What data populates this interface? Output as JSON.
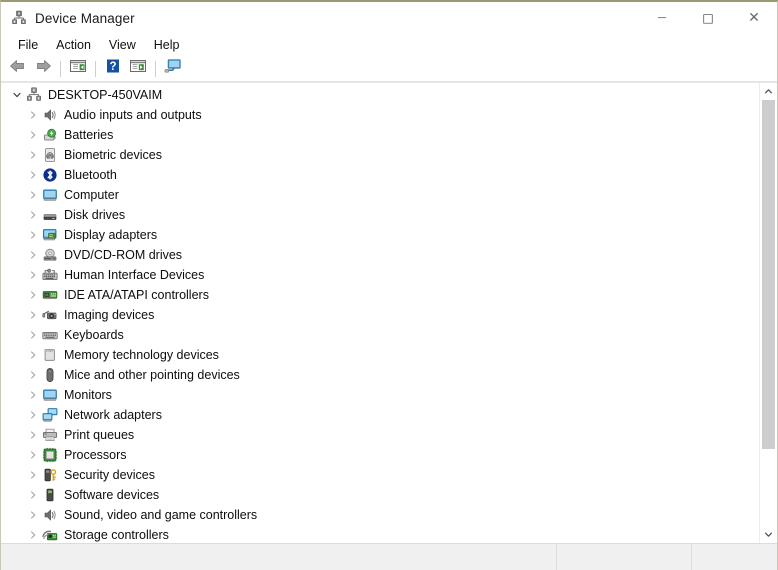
{
  "window": {
    "title": "Device Manager",
    "icon": "device-manager-icon",
    "controls": {
      "minimize": "─",
      "maximize": "□",
      "close": "✕"
    }
  },
  "menubar": {
    "items": [
      {
        "label": "File",
        "name": "menu-file"
      },
      {
        "label": "Action",
        "name": "menu-action"
      },
      {
        "label": "View",
        "name": "menu-view"
      },
      {
        "label": "Help",
        "name": "menu-help"
      }
    ]
  },
  "toolbar": {
    "buttons": [
      {
        "name": "back-button",
        "icon": "back-arrow-icon",
        "tooltip": "Back"
      },
      {
        "name": "forward-button",
        "icon": "forward-arrow-icon",
        "tooltip": "Forward"
      },
      {
        "name": "separator-1",
        "icon": "separator",
        "tooltip": ""
      },
      {
        "name": "show-hide-console-tree-button",
        "icon": "console-tree-icon",
        "tooltip": "Show/Hide Console Tree"
      },
      {
        "name": "separator-2",
        "icon": "separator",
        "tooltip": ""
      },
      {
        "name": "help-button",
        "icon": "help-question-icon",
        "tooltip": "Help"
      },
      {
        "name": "properties-button",
        "icon": "properties-icon",
        "tooltip": "Properties"
      },
      {
        "name": "separator-3",
        "icon": "separator",
        "tooltip": ""
      },
      {
        "name": "scan-for-hardware-changes-button",
        "icon": "monitor-scan-icon",
        "tooltip": "Scan for hardware changes"
      }
    ]
  },
  "tree": {
    "root": {
      "label": "DESKTOP-450VAIM",
      "icon": "computer-node-icon",
      "expanded": true
    },
    "items": [
      {
        "label": "Audio inputs and outputs",
        "icon": "speaker-icon",
        "expanded": false
      },
      {
        "label": "Batteries",
        "icon": "battery-icon",
        "expanded": false
      },
      {
        "label": "Biometric devices",
        "icon": "fingerprint-icon",
        "expanded": false
      },
      {
        "label": "Bluetooth",
        "icon": "bluetooth-icon",
        "expanded": false
      },
      {
        "label": "Computer",
        "icon": "monitor-icon",
        "expanded": false
      },
      {
        "label": "Disk drives",
        "icon": "disk-drive-icon",
        "expanded": false
      },
      {
        "label": "Display adapters",
        "icon": "display-adapter-icon",
        "expanded": false
      },
      {
        "label": "DVD/CD-ROM drives",
        "icon": "optical-drive-icon",
        "expanded": false
      },
      {
        "label": "Human Interface Devices",
        "icon": "hid-keyboard-icon",
        "expanded": false
      },
      {
        "label": "IDE ATA/ATAPI controllers",
        "icon": "ide-controller-icon",
        "expanded": false
      },
      {
        "label": "Imaging devices",
        "icon": "camera-icon",
        "expanded": false
      },
      {
        "label": "Keyboards",
        "icon": "keyboard-icon",
        "expanded": false
      },
      {
        "label": "Memory technology devices",
        "icon": "memory-card-icon",
        "expanded": false
      },
      {
        "label": "Mice and other pointing devices",
        "icon": "mouse-icon",
        "expanded": false
      },
      {
        "label": "Monitors",
        "icon": "monitor-icon",
        "expanded": false
      },
      {
        "label": "Network adapters",
        "icon": "network-adapter-icon",
        "expanded": false
      },
      {
        "label": "Print queues",
        "icon": "printer-icon",
        "expanded": false
      },
      {
        "label": "Processors",
        "icon": "processor-chip-icon",
        "expanded": false
      },
      {
        "label": "Security devices",
        "icon": "security-key-icon",
        "expanded": false
      },
      {
        "label": "Software devices",
        "icon": "software-device-icon",
        "expanded": false
      },
      {
        "label": "Sound, video and game controllers",
        "icon": "speaker-icon",
        "expanded": false
      },
      {
        "label": "Storage controllers",
        "icon": "storage-controller-icon",
        "expanded": false
      }
    ]
  },
  "scrollbar": {
    "up_arrow": "scroll-up-icon",
    "down_arrow": "scroll-down-icon",
    "thumb_position_percent": 0,
    "thumb_size_percent": 82
  },
  "statusbar": {
    "pane1": "",
    "pane2": "",
    "pane3": ""
  },
  "colors": {
    "window_bg": "#ffffff",
    "titlebar_border": "#9a9a6e",
    "statusbar_bg": "#f0f0f0",
    "scrollbar_thumb": "#cdcdcd",
    "text": "#0d0d0d",
    "twisty": "#b0b0b0"
  }
}
